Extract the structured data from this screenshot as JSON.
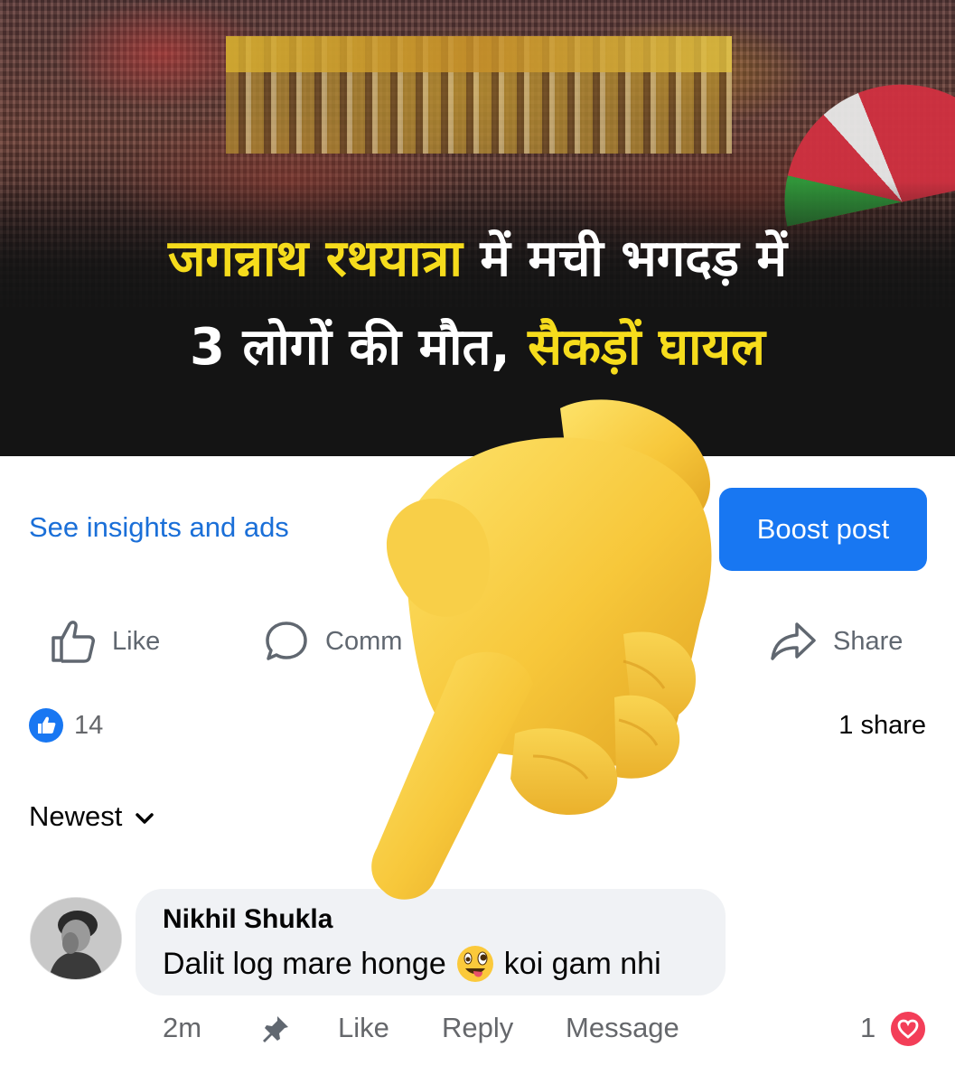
{
  "post": {
    "headline_line1_yellow": "जगन्नाथ रथयात्रा",
    "headline_line1_white": " में मची भगदड़ में",
    "headline_line2_white": "3 लोगों की मौत, ",
    "headline_line2_yellow": "सैकड़ों घायल"
  },
  "insights": {
    "link_label": "See insights and ads",
    "boost_label": "Boost post"
  },
  "actions": {
    "like_label": "Like",
    "comment_label": "Comm",
    "share_label": "Share"
  },
  "stats": {
    "like_count": "14",
    "share_count": "1 share"
  },
  "comments_sort": {
    "label": "Newest"
  },
  "comment": {
    "author": "Nikhil Shukla",
    "text_before": "Dalit log mare honge",
    "text_after": "koi gam nhi",
    "time": "2m",
    "like_label": "Like",
    "reply_label": "Reply",
    "message_label": "Message",
    "reaction_count": "1"
  },
  "colors": {
    "accent": "#1877f2",
    "headline_yellow": "#f6dc1c",
    "link_blue": "#1a6fd8",
    "heart": "#f33e58"
  },
  "icons": [
    "thumbs-up-icon",
    "comment-icon",
    "share-icon",
    "like-badge-icon",
    "chevron-down-icon",
    "pin-icon",
    "heart-icon",
    "winking-face-emoji",
    "pointing-hand-emoji"
  ]
}
